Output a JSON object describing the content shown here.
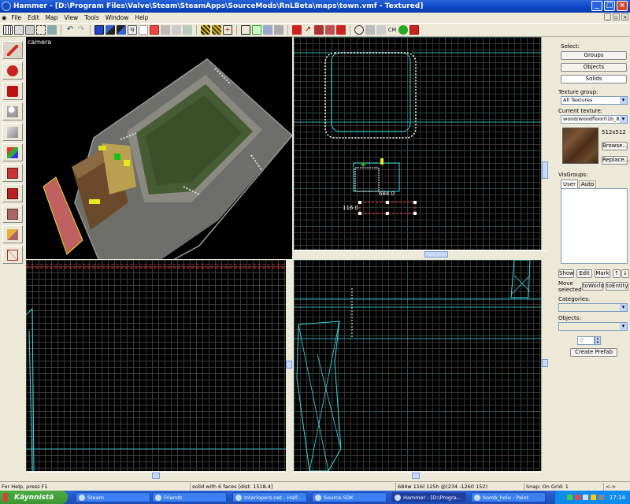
{
  "window": {
    "title": "Hammer - [D:\\Program Files\\Valve\\Steam\\SteamApps\\SourceMods\\RnLBeta\\maps\\town.vmf - Textured]",
    "minimize": "_",
    "maximize": "□",
    "close": "×"
  },
  "menu": [
    "File",
    "Edit",
    "Map",
    "View",
    "Tools",
    "Window",
    "Help"
  ],
  "toolbar": {
    "cm_label": "CM"
  },
  "viewports": {
    "camera_label": "camera",
    "top": {
      "dim_x": "684.0",
      "dim_y": "116.0"
    }
  },
  "panel": {
    "select_label": "Select:",
    "groups": "Groups",
    "objects": "Objects",
    "solids": "Solids",
    "texture_group_label": "Texture group:",
    "texture_group_value": "All Textures",
    "current_texture_label": "Current texture:",
    "current_texture_value": "wood/woodfloor01b_8x",
    "texture_size": "512x512",
    "browse": "Browse...",
    "replace": "Replace...",
    "visgroups_label": "VisGroups:",
    "vis_tabs": [
      "User",
      "Auto"
    ],
    "show": "Show",
    "edit": "Edit",
    "mark": "Mark",
    "up_arrow": "↑",
    "down_arrow": "↓",
    "move_selected": "Move selected",
    "to_world": "toWorld",
    "to_entity": "toEntity",
    "categories_label": "Categories:",
    "objects_label": "Objects:",
    "spinner_value": "0",
    "create_prefab": "Create Prefab"
  },
  "status": {
    "help": "For Help, press F1",
    "selection": "solid with 6 faces   [dist: 1518.4]",
    "size": "684w 116l 125h @(234 -1260 152)",
    "snap": "Snap: On Grid: 1",
    "arrows": "<->"
  },
  "taskbar": {
    "start": "Käynnistä",
    "tasks": [
      "Steam",
      "Friends",
      "Interlopers.net - Half...",
      "Source SDK",
      "Hammer - [D:\\Progra...",
      "bomb_hole - Paint"
    ],
    "clock": "17:14"
  },
  "colors": {
    "title_blue": "#0a46c8",
    "wire_cyan": "#40d8e0",
    "selection_red": "#ff3030",
    "taskbar_blue": "#2456c6",
    "start_green": "#3a9732"
  }
}
